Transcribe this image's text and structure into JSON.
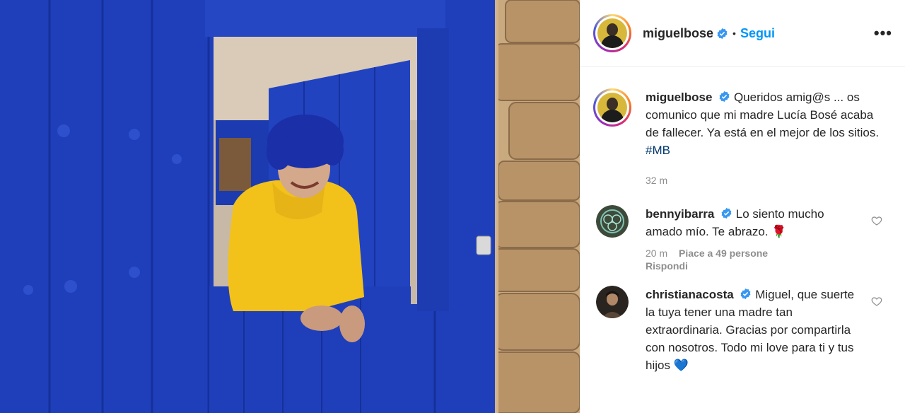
{
  "header": {
    "username": "miguelbose",
    "separator": "•",
    "follow_label": "Segui",
    "more_label": "•••"
  },
  "caption": {
    "username": "miguelbose",
    "text": "Queridos amig@s ... os comunico que mi madre Lucía Bosé acaba de fallecer. Ya está en el mejor de los sitios.",
    "hashtag": "#MB",
    "time": "32 m"
  },
  "comments": [
    {
      "username": "bennyibarra",
      "text": "Lo siento mucho amado mío. Te abrazo. 🌹",
      "time": "20 m",
      "likes": "Piace a 49 persone",
      "reply": "Rispondi"
    },
    {
      "username": "christianacosta",
      "text": "Miguel, que suerte la tuya tener una madre tan extraordinaria. Gracias por compartirla con nosotros. Todo mi love para ti y tus hijos 💙"
    }
  ],
  "icons": {
    "verified": "verified-badge-icon",
    "heart": "heart-outline-icon",
    "more": "more-options-icon"
  },
  "colors": {
    "accent": "#0095f6",
    "hashtag": "#00376b",
    "muted": "#8e8e8e",
    "door_blue": "#1e3fb8",
    "sweater": "#f2c21b"
  }
}
